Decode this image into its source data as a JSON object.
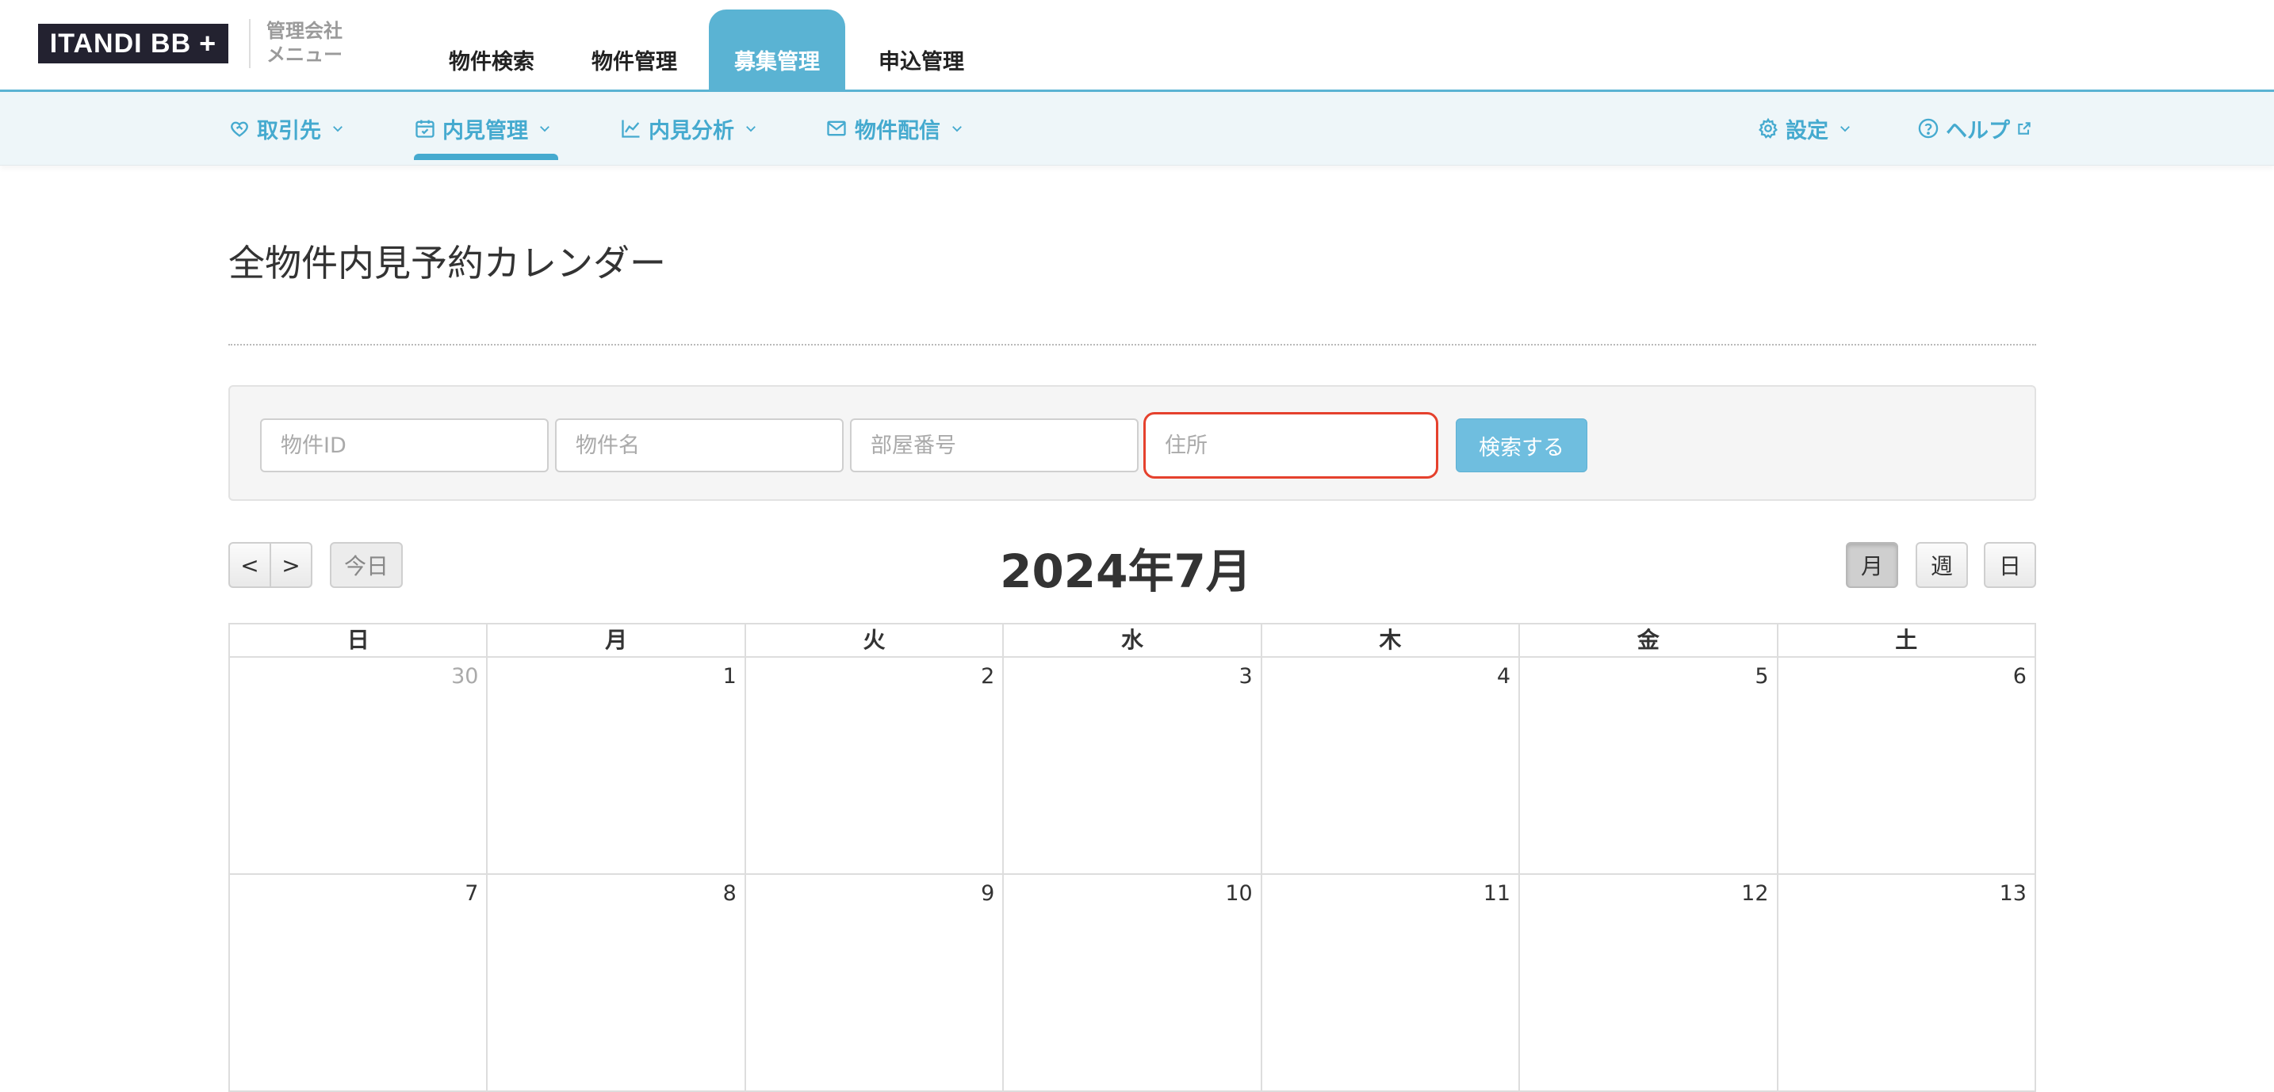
{
  "header": {
    "logo_text": "ITANDI BB",
    "logo_plus": "+",
    "mgmt_line1": "管理会社",
    "mgmt_line2": "メニュー",
    "tabs": [
      {
        "label": "物件検索"
      },
      {
        "label": "物件管理"
      },
      {
        "label": "募集管理",
        "active": true
      },
      {
        "label": "申込管理"
      }
    ]
  },
  "subnav": {
    "items": [
      {
        "label": "取引先",
        "icon": "handshake-heart-icon"
      },
      {
        "label": "内見管理",
        "icon": "calendar-check-icon",
        "active": true
      },
      {
        "label": "内見分析",
        "icon": "line-chart-icon"
      },
      {
        "label": "物件配信",
        "icon": "envelope-icon"
      }
    ],
    "right": [
      {
        "label": "設定",
        "icon": "gear-icon"
      },
      {
        "label": "ヘルプ",
        "icon": "help-circle-icon"
      }
    ]
  },
  "page": {
    "title": "全物件内見予約カレンダー"
  },
  "search": {
    "fields": [
      {
        "placeholder": "物件ID",
        "value": ""
      },
      {
        "placeholder": "物件名",
        "value": ""
      },
      {
        "placeholder": "部屋番号",
        "value": ""
      },
      {
        "placeholder": "住所",
        "value": ""
      }
    ],
    "button_label": "検索する"
  },
  "calendar": {
    "prev_label": "<",
    "next_label": ">",
    "today_label": "今日",
    "title": "2024年7月",
    "views": [
      {
        "label": "月",
        "active": true
      },
      {
        "label": "週"
      },
      {
        "label": "日"
      }
    ],
    "weekdays": [
      "日",
      "月",
      "火",
      "水",
      "木",
      "金",
      "土"
    ],
    "weeks": [
      [
        {
          "day": "30",
          "other": true
        },
        {
          "day": "1"
        },
        {
          "day": "2"
        },
        {
          "day": "3"
        },
        {
          "day": "4"
        },
        {
          "day": "5"
        },
        {
          "day": "6"
        }
      ],
      [
        {
          "day": "7"
        },
        {
          "day": "8"
        },
        {
          "day": "9"
        },
        {
          "day": "10"
        },
        {
          "day": "11"
        },
        {
          "day": "12"
        },
        {
          "day": "13"
        }
      ]
    ]
  },
  "colors": {
    "accent": "#45aacf",
    "tab_active": "#5ab3d3",
    "highlight_border": "#e5412d",
    "logo_bg": "#232230"
  }
}
